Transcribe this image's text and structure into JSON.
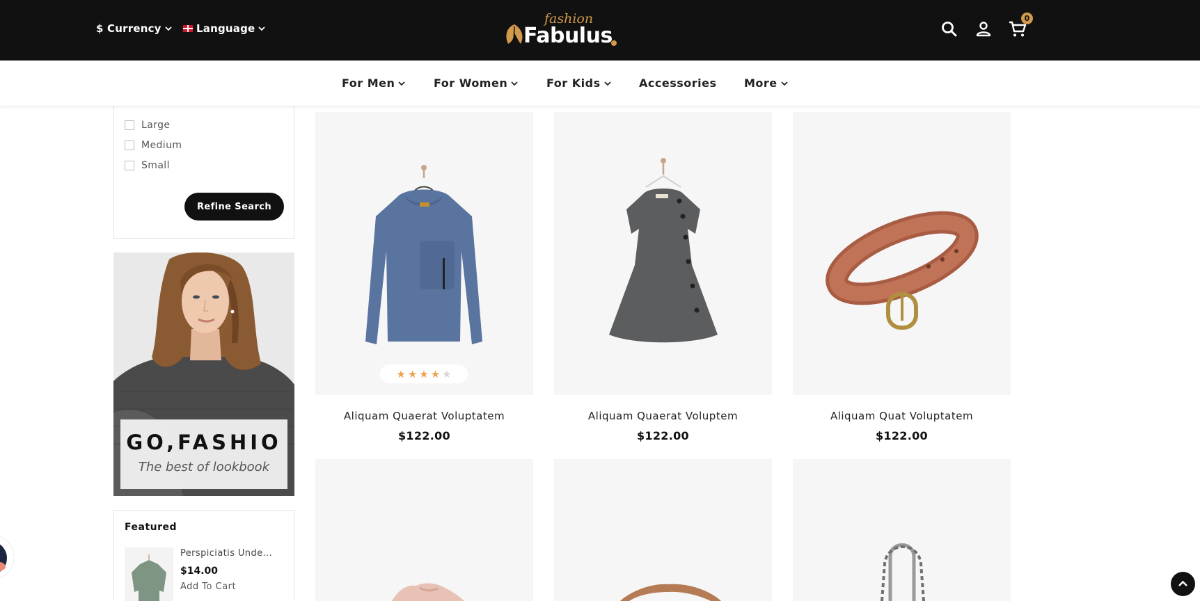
{
  "header": {
    "currency_label": "$ Currency",
    "language_label": "Language",
    "logo_script": "fashion",
    "logo_word": "Fabulus",
    "cart_count": "0"
  },
  "nav": {
    "items": [
      {
        "label": "For Men"
      },
      {
        "label": "For Women"
      },
      {
        "label": "For Kids"
      },
      {
        "label": "Accessories"
      },
      {
        "label": "More"
      }
    ]
  },
  "filter": {
    "options": [
      {
        "label": "Large"
      },
      {
        "label": "Medium"
      },
      {
        "label": "Small"
      }
    ],
    "refine_label": "Refine Search"
  },
  "banner": {
    "title": "GO,FASHIO",
    "subtitle": "The best of lookbook"
  },
  "featured": {
    "title": "Featured",
    "item": {
      "name": "Perspiciatis Unde...",
      "price": "$14.00",
      "cart_label": "Add To Cart"
    }
  },
  "products": [
    {
      "name": "Aliquam Quaerat Voluptatem",
      "price": "$122.00",
      "rating": 4,
      "rating_max": 5,
      "icon": "sweater"
    },
    {
      "name": "Aliquam Quaerat Voluptem",
      "price": "$122.00",
      "icon": "dress"
    },
    {
      "name": "Aliquam Quat Voluptatem",
      "price": "$122.00",
      "icon": "belt"
    },
    {
      "icon": "shoe"
    },
    {
      "icon": "sandal"
    },
    {
      "icon": "handbag"
    }
  ],
  "colors": {
    "topbar": "#111111",
    "accent": "#d29a4c",
    "star": "#f0a04b",
    "card_bg": "#f6f6f6"
  }
}
